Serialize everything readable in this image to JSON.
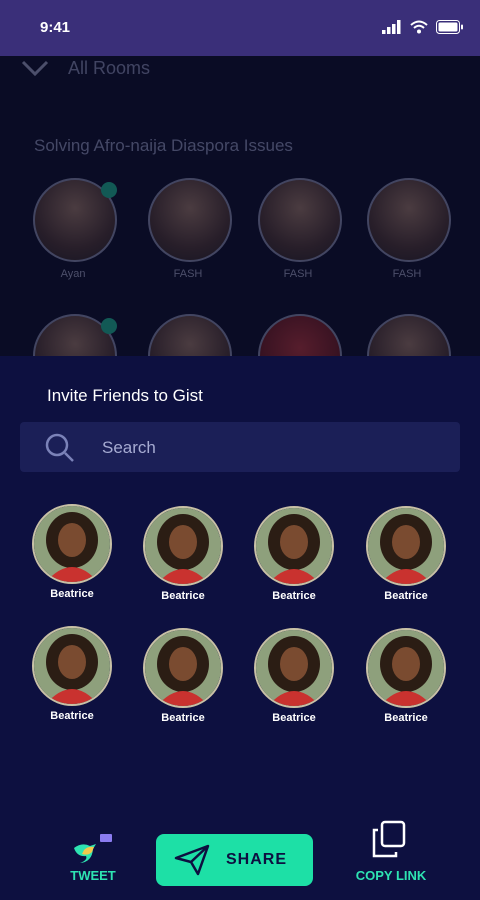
{
  "status_bar": {
    "time": "9:41"
  },
  "room": {
    "dropdown_label": "All Rooms",
    "title": "Solving Afro-naija Diaspora Issues",
    "speakers": [
      {
        "name": "Ayan"
      },
      {
        "name": "FASH"
      },
      {
        "name": "FASH"
      },
      {
        "name": "FASH"
      }
    ]
  },
  "invite": {
    "title": "Invite Friends to Gist",
    "search_placeholder": "Search",
    "friends": [
      {
        "name": "Beatrice"
      },
      {
        "name": "Beatrice"
      },
      {
        "name": "Beatrice"
      },
      {
        "name": "Beatrice"
      },
      {
        "name": "Beatrice"
      },
      {
        "name": "Beatrice"
      },
      {
        "name": "Beatrice"
      },
      {
        "name": "Beatrice"
      }
    ]
  },
  "actions": {
    "tweet_label": "TWEET",
    "share_label": "SHARE",
    "copy_label": "COPY LINK"
  },
  "colors": {
    "accent": "#1de0a6",
    "background": "#0d1040",
    "status_bar": "#3a2f79"
  }
}
